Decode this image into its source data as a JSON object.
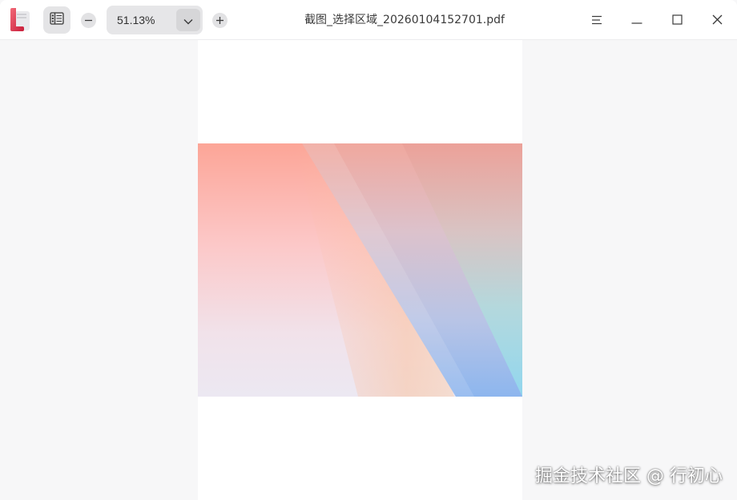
{
  "toolbar": {
    "zoom_value": "51.13%"
  },
  "titlebar": {
    "document_title": "截图_选择区域_20260104152701.pdf"
  },
  "icons": {
    "app_logo": "document-viewer-logo-icon",
    "thumbnails": "thumbnails-icon",
    "zoom_out": "minus-icon",
    "zoom_dropdown": "chevron-down-icon",
    "zoom_in": "plus-icon",
    "menu": "menu-icon",
    "minimize": "minimize-icon",
    "maximize": "maximize-icon",
    "close": "close-icon"
  },
  "colors": {
    "accent_logo": "#d8344a",
    "titlebar_bg": "#ffffff",
    "viewer_bg": "#f7f7f8"
  },
  "watermark": {
    "text": "掘金技术社区 @ 行初心"
  }
}
